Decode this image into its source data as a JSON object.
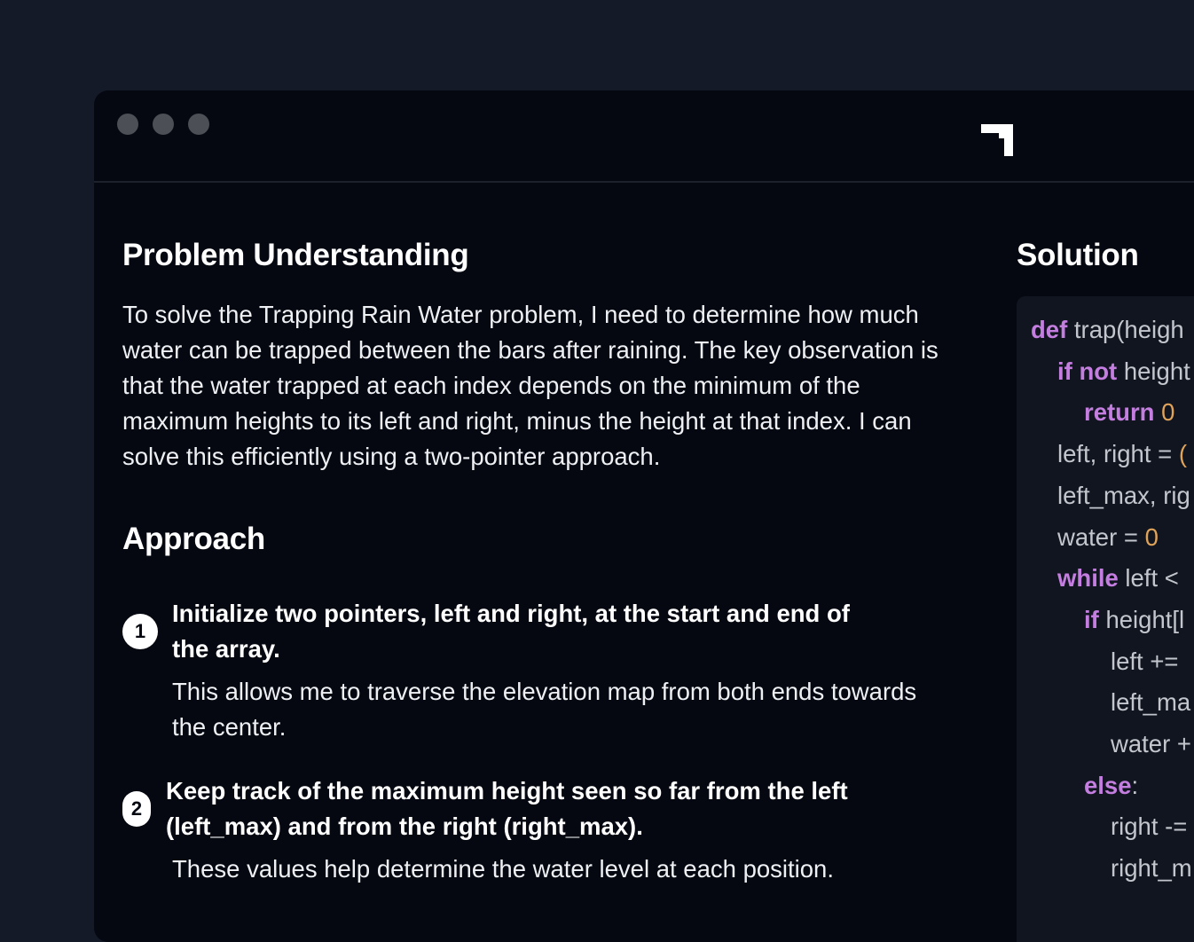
{
  "window": {
    "title_dots": [
      "close",
      "minimize",
      "maximize"
    ],
    "logo_icon": "app-logo-icon"
  },
  "problem": {
    "heading": "Problem Understanding",
    "lines": [
      "To solve the Trapping Rain Water problem, I need to determine how much",
      "water can be trapped between the bars after raining. The key observation is",
      "that the water trapped at each index depends on the minimum of the",
      "maximum heights to its left and right, minus the height at that index. I can",
      "solve this efficiently using a two-pointer approach."
    ]
  },
  "approach": {
    "heading": "Approach",
    "steps": [
      {
        "number": "1",
        "title_lines": [
          "Initialize two pointers, left and right, at the start and end of",
          "the array."
        ],
        "desc_lines": [
          "This allows me to traverse the elevation map from both ends towards",
          "the center."
        ]
      },
      {
        "number": "2",
        "title_lines": [
          "Keep track of the maximum height seen so far from the left",
          "(left_max) and from the right (right_max)."
        ],
        "desc_lines": [
          "These values help determine the water level at each position."
        ]
      }
    ]
  },
  "solution": {
    "heading": "Solution",
    "code": [
      {
        "kw": "def",
        "text": " trap(heigh"
      },
      {
        "kw": "if not",
        "text": " height"
      },
      {
        "kw": "return",
        "text": " ",
        "num": "0"
      },
      {
        "kw": "",
        "text": "left, right = ",
        "num": "("
      },
      {
        "kw": "",
        "text": "left_max, rig"
      },
      {
        "kw": "",
        "text": "water = ",
        "num": "0"
      },
      {
        "kw": "while",
        "text": " left <"
      },
      {
        "kw": "if",
        "text": " height[l"
      },
      {
        "kw": "",
        "text": "left +="
      },
      {
        "kw": "",
        "text": "left_ma"
      },
      {
        "kw": "",
        "text": "water +"
      },
      {
        "kw": "else",
        "text": ":"
      },
      {
        "kw": "",
        "text": "right -="
      },
      {
        "kw": "",
        "text": "right_m"
      }
    ]
  },
  "colors": {
    "background": "#141a27",
    "window": "#050811",
    "code_panel": "#11151f",
    "keyword": "#c47ee0",
    "number": "#e0a35a"
  }
}
